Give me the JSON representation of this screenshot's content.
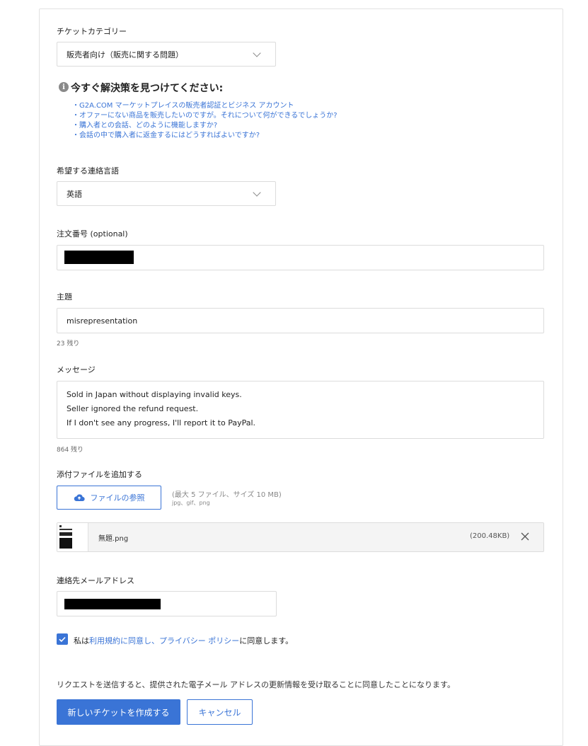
{
  "category": {
    "label": "チケットカテゴリー",
    "selected": "販売者向け（販売に関する問題）"
  },
  "help": {
    "icon": "info-icon",
    "title": "今すぐ解決策を見つけてください:",
    "links": [
      "・G2A.COM マーケットプレイスの販売者認証とビジネス アカウント",
      "・オファーにない商品を販売したいのですが。それについて何ができるでしょうか?",
      "・購入者との会話、どのように機能しますか?",
      "・会話の中で購入者に返金するにはどうすればよいですか?"
    ]
  },
  "language": {
    "label": "希望する連絡言語",
    "selected": "英語"
  },
  "order": {
    "label": "注文番号 (optional)"
  },
  "subject": {
    "label": "主題",
    "value": "misrepresentation",
    "remaining": "23 残り"
  },
  "message": {
    "label": "メッセージ",
    "lines": [
      "Sold in Japan without displaying invalid keys.",
      "Seller ignored the refund request.",
      "If I don't see any progress, I'll report it to PayPal."
    ],
    "remaining": "864 残り"
  },
  "attachments": {
    "label": "添付ファイルを追加する",
    "browse_label": "ファイルの参照",
    "limits": "(最大 5 ファイル、サイズ 10 MB)",
    "types": "jpg、gif、png",
    "file": {
      "name": "無題.png",
      "size": "(200.48KB)"
    }
  },
  "email": {
    "label": "連絡先メールアドレス"
  },
  "consent": {
    "prefix": "私は",
    "terms_link": "利用規約に同意し、プライバシー ポリシー",
    "suffix": "に同意します。"
  },
  "notice": "リクエストを送信すると、提供された電子メール アドレスの更新情報を受け取ることに同意したことになります。",
  "actions": {
    "submit_label": "新しいチケットを作成する",
    "cancel_label": "キャンセル"
  },
  "colors": {
    "accent": "#3a74d6",
    "border": "#dcdcdc"
  }
}
